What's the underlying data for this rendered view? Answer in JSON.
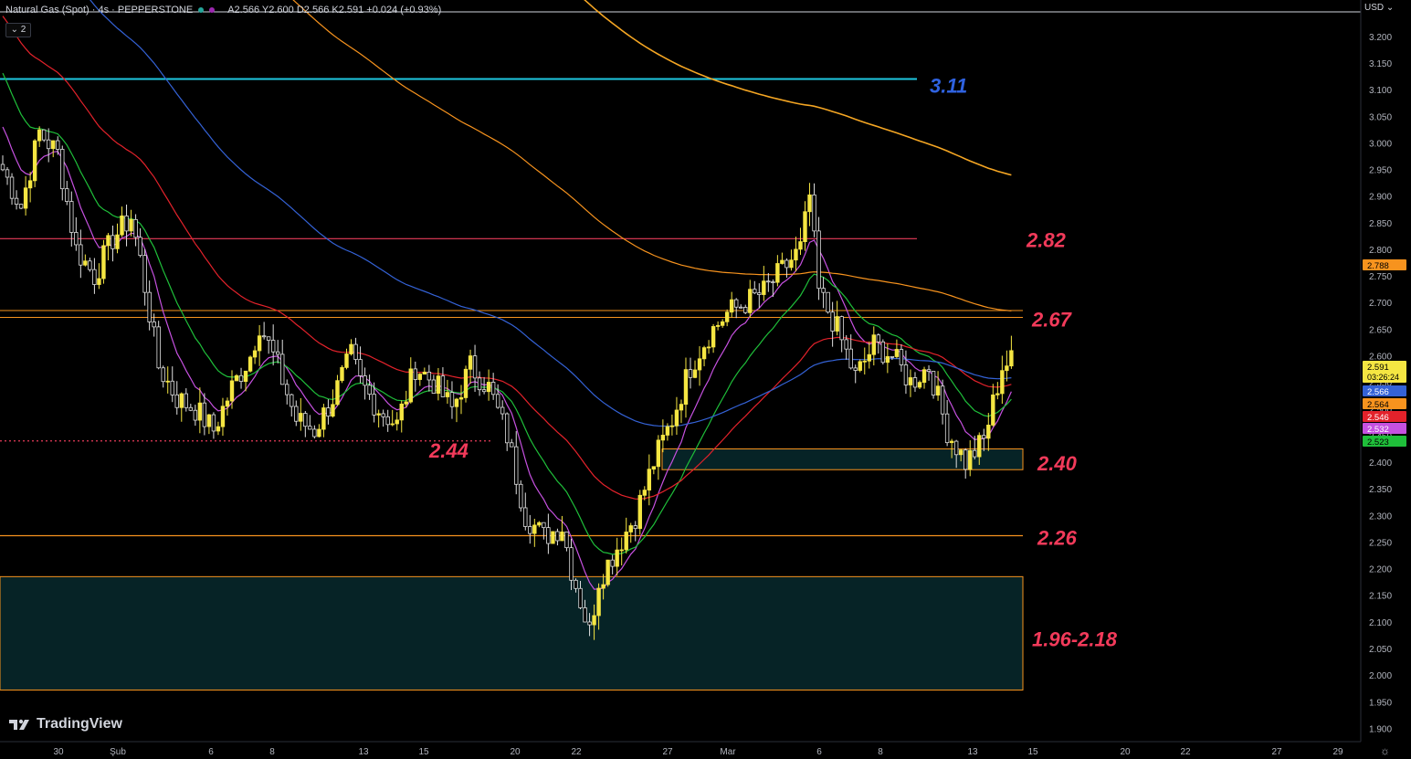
{
  "header": {
    "symbol": "Natural Gas (Spot) · 4s · PEPPERSTONE",
    "ohlc": "A2.566 Y2.600 D2.566 K2.591 +0.024 (+0.93%)",
    "collapse": "⌄ 2"
  },
  "currency_label": "USD",
  "branding": "TradingView",
  "colors": {
    "background": "#000000",
    "candle": "#f5e642",
    "ema_violet": "#c651e0",
    "ema_green": "#1fbf3a",
    "ema_red": "#e3222b",
    "ema_blue": "#3462d6",
    "ema_orange": "#f7931e",
    "level_cyan": "#1ec8e0",
    "level_red": "#e83c5a",
    "level_orange": "#f7931e",
    "zone_fill": "#062326",
    "annotation": "#f23a5a",
    "annotation_blue": "#2f62e0"
  },
  "chart_data": {
    "type": "candlestick",
    "y_axis": {
      "range": [
        1.875,
        3.265
      ],
      "ticks": [
        "3.200",
        "3.150",
        "3.100",
        "3.050",
        "3.000",
        "2.950",
        "2.900",
        "2.850",
        "2.800",
        "2.750",
        "2.700",
        "2.650",
        "2.600",
        "2.550",
        "2.500",
        "2.450",
        "2.400",
        "2.350",
        "2.300",
        "2.250",
        "2.200",
        "2.150",
        "2.100",
        "2.050",
        "2.000",
        "1.950",
        "1.900"
      ]
    },
    "x_axis": {
      "ticks": [
        "30",
        "Şub",
        "6",
        "8",
        "13",
        "15",
        "20",
        "22",
        "27",
        "Mar",
        "6",
        "8",
        "13",
        "15",
        "20",
        "22",
        "27",
        "29"
      ]
    },
    "price_tags": [
      {
        "value": "2.788",
        "color": "#f7931e"
      },
      {
        "value": "2.591",
        "color": "#f5e642",
        "countdown": "03:26:24"
      },
      {
        "value": "2.566",
        "color": "#3462d6"
      },
      {
        "value": "2.564",
        "color": "#f7931e"
      },
      {
        "value": "2.546",
        "color": "#e3222b"
      },
      {
        "value": "2.532",
        "color": "#c651e0"
      },
      {
        "value": "2.523",
        "color": "#1fbf3a"
      }
    ],
    "levels": [
      {
        "value": 3.12,
        "color": "#1ec8e0",
        "label": "3.11",
        "label_color": "#2f62e0"
      },
      {
        "value": 2.82,
        "color": "#e83c5a",
        "label": "2.82",
        "label_color": "#f23a5a"
      },
      {
        "value_low": 2.672,
        "value_high": 2.685,
        "color": "#f7931e",
        "label": "2.67",
        "label_color": "#f23a5a"
      },
      {
        "value": 2.44,
        "color": "#e83c5a",
        "dotted": true,
        "label": "2.44",
        "label_color": "#f23a5a"
      },
      {
        "value_low": 2.386,
        "value_high": 2.425,
        "color": "#f7931e",
        "zone": true,
        "label": "2.40",
        "label_color": "#f23a5a"
      },
      {
        "value": 2.262,
        "color": "#f7931e",
        "label": "2.26",
        "label_color": "#f23a5a"
      },
      {
        "value_low": 1.972,
        "value_high": 2.185,
        "color": "#f7931e",
        "zone": true,
        "label": "1.96-2.18",
        "label_color": "#f23a5a"
      }
    ],
    "anchors": [
      [
        0,
        2.95
      ],
      [
        4,
        2.88
      ],
      [
        8,
        3.02
      ],
      [
        12,
        2.98
      ],
      [
        16,
        2.8
      ],
      [
        20,
        2.75
      ],
      [
        24,
        2.82
      ],
      [
        28,
        2.86
      ],
      [
        30,
        2.78
      ],
      [
        34,
        2.58
      ],
      [
        38,
        2.52
      ],
      [
        42,
        2.5
      ],
      [
        46,
        2.46
      ],
      [
        50,
        2.54
      ],
      [
        54,
        2.6
      ],
      [
        56,
        2.66
      ],
      [
        60,
        2.58
      ],
      [
        64,
        2.48
      ],
      [
        68,
        2.46
      ],
      [
        72,
        2.52
      ],
      [
        76,
        2.6
      ],
      [
        78,
        2.55
      ],
      [
        82,
        2.5
      ],
      [
        86,
        2.47
      ],
      [
        90,
        2.58
      ],
      [
        94,
        2.55
      ],
      [
        98,
        2.5
      ],
      [
        102,
        2.58
      ],
      [
        106,
        2.54
      ],
      [
        110,
        2.45
      ],
      [
        114,
        2.3
      ],
      [
        118,
        2.26
      ],
      [
        122,
        2.28
      ],
      [
        124,
        2.2
      ],
      [
        128,
        2.08
      ],
      [
        130,
        2.18
      ],
      [
        134,
        2.24
      ],
      [
        138,
        2.3
      ],
      [
        142,
        2.4
      ],
      [
        146,
        2.48
      ],
      [
        150,
        2.58
      ],
      [
        154,
        2.64
      ],
      [
        158,
        2.68
      ],
      [
        162,
        2.7
      ],
      [
        166,
        2.72
      ],
      [
        170,
        2.76
      ],
      [
        174,
        2.8
      ],
      [
        176,
        2.9
      ],
      [
        178,
        2.72
      ],
      [
        182,
        2.65
      ],
      [
        186,
        2.56
      ],
      [
        190,
        2.62
      ],
      [
        194,
        2.6
      ],
      [
        198,
        2.55
      ],
      [
        202,
        2.58
      ],
      [
        206,
        2.46
      ],
      [
        210,
        2.4
      ],
      [
        214,
        2.44
      ],
      [
        218,
        2.58
      ],
      [
        220,
        2.59
      ]
    ],
    "total_bars": 221
  }
}
